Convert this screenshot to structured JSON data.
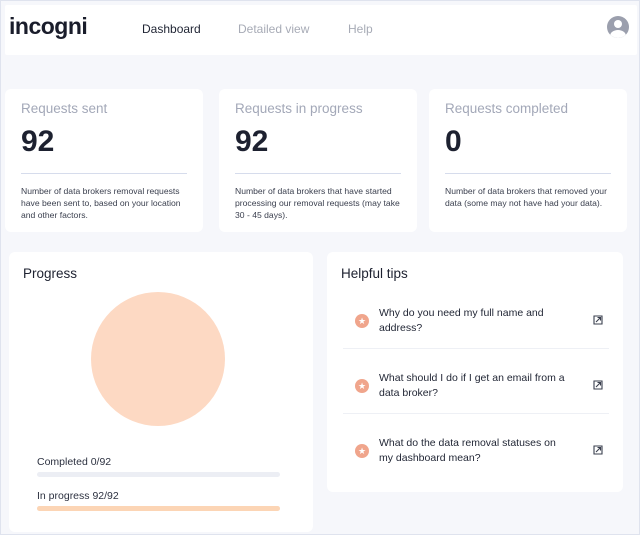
{
  "app": {
    "logo": "incogni"
  },
  "nav": {
    "items": [
      {
        "label": "Dashboard",
        "active": true
      },
      {
        "label": "Detailed view",
        "active": false
      },
      {
        "label": "Help",
        "active": false
      }
    ]
  },
  "stats": [
    {
      "title": "Requests sent",
      "value": "92",
      "description": "Number of data brokers removal requests have been sent to, based on your location and other factors."
    },
    {
      "title": "Requests in progress",
      "value": "92",
      "description": "Number of data brokers that have started processing our removal requests (may take 30 - 45 days)."
    },
    {
      "title": "Requests completed",
      "value": "0",
      "description": "Number of data brokers that removed your data (some may not have had your data)."
    }
  ],
  "progress": {
    "title": "Progress",
    "completed_label": "Completed 0/92",
    "completed_fraction": 0,
    "in_progress_label": "In progress 92/92",
    "in_progress_fraction": 1,
    "pie_color": "#fdd9c3",
    "bar_color": "#fcd5b5"
  },
  "tips": {
    "title": "Helpful tips",
    "items": [
      {
        "text": "Why do you need my full name and address?"
      },
      {
        "text": "What should I do if I get an email from a data broker?"
      },
      {
        "text": "What do the data removal statuses on my dashboard mean?"
      }
    ],
    "star_color": "#f0a58c"
  }
}
